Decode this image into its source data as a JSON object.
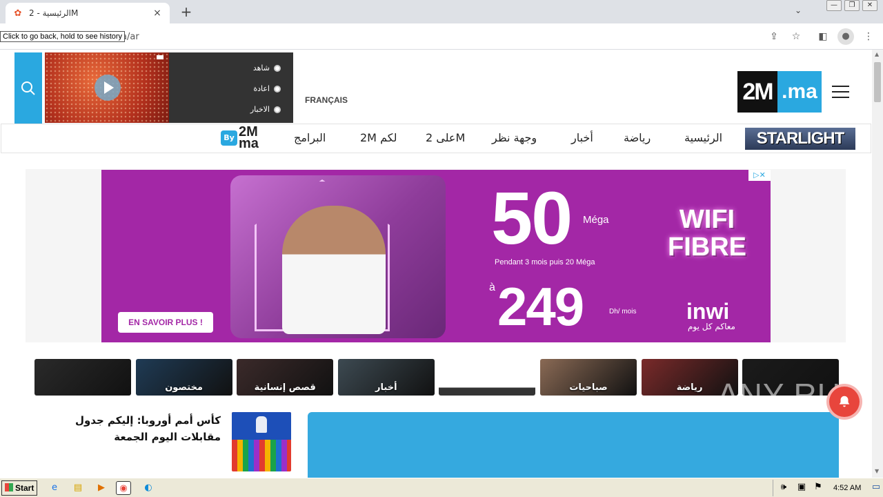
{
  "browser": {
    "tab_title": "الرئيسية - 2M",
    "tab_close": "×",
    "new_tab": "+",
    "url_suffix": "a/ar",
    "tooltip": "Click to go back, hold to see history"
  },
  "header": {
    "live_menu": [
      "شاهد",
      "اعادة",
      "الاخبار"
    ],
    "language_link": "FRANÇAIS",
    "logo_left": "2M",
    "logo_right": ".ma"
  },
  "nav": {
    "brand": "STARLIGHT",
    "items": [
      "الرئيسية",
      "رياضة",
      "أخبار",
      "وجهة نظر",
      "على 2M",
      "2M لكم",
      "البرامج"
    ],
    "by_badge": "By",
    "by_logo": "2M ma"
  },
  "ad": {
    "cta": "EN SAVOIR PLUS !",
    "speed": "50",
    "speed_unit": "Méga",
    "offer_line": "Pendant 3 mois puis 20 Méga",
    "price_prefix": "à",
    "price": "249",
    "price_unit": "Dh/ mois",
    "product": "WIFI FIBRE",
    "brand": "inwi",
    "brand_tagline": "معاكم كل يوم",
    "close": "▷✕"
  },
  "thumbnails": [
    {
      "label": "",
      "color": "#2a2a2a"
    },
    {
      "label": "مختصون",
      "color": "#1f3b55"
    },
    {
      "label": "قصص إنسانية",
      "color": "#3b2a2a"
    },
    {
      "label": "أخبار",
      "color": "#3d4a52"
    },
    {
      "label": "",
      "color": "#ffffff"
    },
    {
      "label": "صباحيات",
      "color": "#8a6a55"
    },
    {
      "label": "رياضة",
      "color": "#7a2a2a"
    },
    {
      "label": "",
      "color": "#1b1b1b"
    }
  ],
  "article": {
    "title": "كأس أمم أوروبا: إليكم جدول مقابلات اليوم الجمعة"
  },
  "watermark": "ANY RUN",
  "taskbar": {
    "start": "Start",
    "clock": "4:52 AM"
  }
}
